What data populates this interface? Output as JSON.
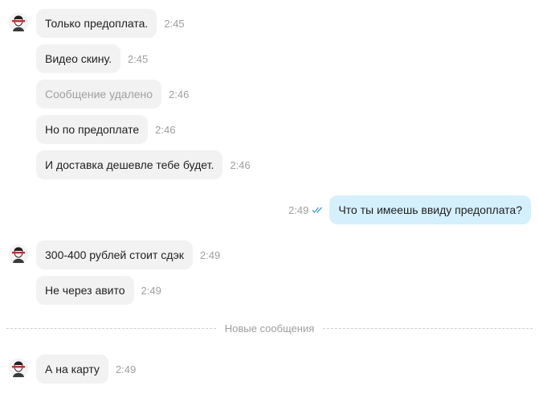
{
  "messages_group_1": [
    {
      "text": "Только предоплата.",
      "time": "2:45"
    },
    {
      "text": "Видео скину.",
      "time": "2:45"
    },
    {
      "text": "Сообщение удалено",
      "time": "2:46"
    },
    {
      "text": "Но по предоплате",
      "time": "2:46"
    },
    {
      "text": "И доставка дешевле тебе будет.",
      "time": "2:46"
    }
  ],
  "outgoing": {
    "text": "Что ты имеешь ввиду предоплата?",
    "time": "2:49",
    "status_icon": "double-check-icon",
    "accent": "#3a9fd8",
    "bubble_color": "#d4f0fd"
  },
  "messages_group_2": [
    {
      "text": "300-400 рублей стоит сдэк",
      "time": "2:49"
    },
    {
      "text": "Не через авито",
      "time": "2:49"
    }
  ],
  "divider": {
    "label": "Новые сообщения"
  },
  "messages_group_3": [
    {
      "text": "А на карту",
      "time": "2:49"
    }
  ],
  "avatar_icon": "user-avatar-icon"
}
